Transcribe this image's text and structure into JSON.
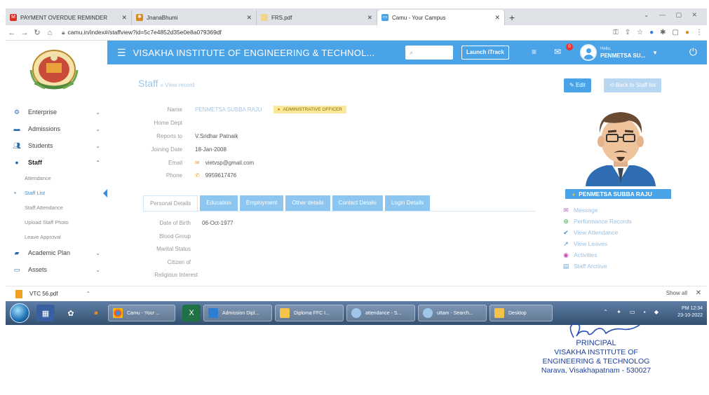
{
  "browser": {
    "tabs": [
      {
        "label": "PAYMENT OVERDUE REMINDER",
        "active": false
      },
      {
        "label": "JnanaBhumi",
        "active": false
      },
      {
        "label": "FRS.pdf",
        "active": false
      },
      {
        "label": "Camu - Your Campus",
        "active": true
      }
    ],
    "url": "camu.in/index#/staffview?id=5c7e4852d35e0e8a079369df"
  },
  "app": {
    "institution": "VISAKHA INSTITUTE OF ENGINEERING & TECHNOL...",
    "launch_itrack": "Launch iTrack",
    "notification_count": "0",
    "user_greeting": "Hello,",
    "user_name": "PENMETSA SU..."
  },
  "sidebar": {
    "items": [
      {
        "label": "Enterprise",
        "icon": "network-icon"
      },
      {
        "label": "Admissions",
        "icon": "form-icon"
      },
      {
        "label": "Students",
        "icon": "users-icon"
      },
      {
        "label": "Staff",
        "icon": "person-icon"
      }
    ],
    "staff_sub": [
      "Attendance",
      "Staff List",
      "Staff Attendance",
      "Upload Staff Photo",
      "Leave Approval"
    ],
    "items_after": [
      {
        "label": "Academic Plan",
        "icon": "book-icon"
      },
      {
        "label": "Assets",
        "icon": "monitor-icon"
      }
    ]
  },
  "page": {
    "title": "Staff",
    "subtitle": "» View record",
    "edit_button": "Edit",
    "back_button": "Back to Staff list"
  },
  "record": {
    "name_label": "Name",
    "name_value": "PENMETSA SUBBA RAJU",
    "designation": "ADMINISTRATIVE OFFICER",
    "home_dept_label": "Home Dept",
    "reports_to_label": "Reports to",
    "reports_to_value": "V.Sridhar Patnaik",
    "joining_label": "Joining Date",
    "joining_value": "18-Jan-2008",
    "email_label": "Email",
    "email_value": "vietvsp@gmail.com",
    "phone_label": "Phone",
    "phone_value": "9959617476"
  },
  "profile_tabs": [
    "Personal Details",
    "Education",
    "Employment",
    "Other details",
    "Contact Details",
    "Login Details"
  ],
  "personal": {
    "dob_label": "Date of Birth",
    "dob_value": "06-Oct-1977",
    "blood_label": "Blood Group",
    "marital_label": "Marital Status",
    "citizen_label": "Citizen of",
    "religious_label": "Religious Interest"
  },
  "profile_card": {
    "name": "PENMETSA SUBBA RAJU",
    "actions": [
      {
        "label": "Message",
        "icon": "envelope-icon",
        "color": "#b564c9"
      },
      {
        "label": "Performance Records",
        "icon": "plus-circle-icon",
        "color": "#4cb050"
      },
      {
        "label": "View Attendance",
        "icon": "check-icon",
        "color": "#3b8fd6"
      },
      {
        "label": "View Leaves",
        "icon": "external-link-icon",
        "color": "#3b8fd6"
      },
      {
        "label": "Activities",
        "icon": "record-icon",
        "color": "#c94bb0"
      },
      {
        "label": "Staff Archive",
        "icon": "archive-icon",
        "color": "#7aa6d6"
      }
    ]
  },
  "downloads": {
    "file": "VTC 56.pdf",
    "show_all": "Show all"
  },
  "taskbar": {
    "windows": [
      {
        "label": "Camu - Your ...",
        "color": "#ffffff"
      },
      {
        "label": "Admission Dipl...",
        "color": "#2c7cd1"
      },
      {
        "label": "Diploma FFC I...",
        "color": "#f3c34a"
      },
      {
        "label": "attendance - S...",
        "color": "#9fc6ea"
      },
      {
        "label": "uttam - Search...",
        "color": "#9fc6ea"
      },
      {
        "label": "Desktop",
        "color": "#f3c34a"
      }
    ],
    "time": "PM 12:34",
    "date": "23-10-2022"
  },
  "stamp": {
    "line1": "PRINCIPAL",
    "line2": "VISAKHA INSTITUTE OF",
    "line3": "ENGINEERING & TECHNOLOG",
    "line4": "Narava, Visakhapatnam - 530027"
  }
}
